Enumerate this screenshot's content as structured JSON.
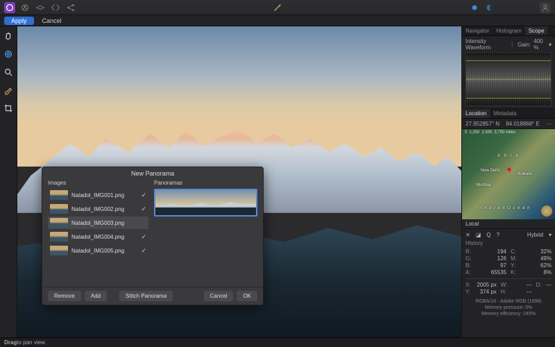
{
  "actionbar": {
    "apply": "Apply",
    "cancel": "Cancel"
  },
  "tabs": {
    "navigator": "Navigator",
    "histogram": "Histogram",
    "scope": "Scope"
  },
  "scope": {
    "title": "Intensity Waveform",
    "gain_label": "Gain:",
    "gain_value": "400 %"
  },
  "location": {
    "tab_location": "Location",
    "tab_metadata": "Metadata",
    "lat": "27.952857° N",
    "lon": "84.018868° E",
    "scale_0": "0",
    "scale_1": "1,250",
    "scale_2": "2,500",
    "scale_3": "3,750 miles",
    "label_asia": "A  S  I  A",
    "label_newdelhi": "New Delhi",
    "label_kolkata": "Kolkata",
    "label_mumbai": "Mumbai",
    "label_ocean": "I n d i a n   O c e a n",
    "local": "Local"
  },
  "info": {
    "tab_history": "History",
    "hybrid": "Hybrid",
    "R_lbl": "R:",
    "R": "194",
    "G_lbl": "G:",
    "G": "126",
    "B_lbl": "B:",
    "B": "97",
    "A_lbl": "A:",
    "A": "65535",
    "C_lbl": "C:",
    "C": "32%",
    "M_lbl": "M:",
    "M": "49%",
    "Y_lbl": "Y:",
    "Y": "62%",
    "K_lbl": "K:",
    "K": "8%",
    "X_lbl": "X:",
    "X": "2005 px",
    "Ypx_lbl": "Y:",
    "Ypx": "374 px",
    "W_lbl": "W:",
    "W": "---",
    "D_lbl": "D:",
    "D": "---",
    "H_lbl": "H:",
    "H": "---",
    "profile": "RGBA/16 - Adobe RGB (1998)",
    "mem_pressure": "Memory pressure: 0%",
    "mem_eff": "Memory efficiency: 245%"
  },
  "status": {
    "hint_strong": "Drag",
    "hint_rest": " to pan view."
  },
  "dialog": {
    "title": "New Panorama",
    "images_label": "Images",
    "panoramas_label": "Panoramas",
    "images": [
      {
        "name": "Natadol_IMG001.png",
        "checked": true,
        "sel": false
      },
      {
        "name": "Natadol_IMG002.png",
        "checked": true,
        "sel": false
      },
      {
        "name": "Natadol_IMG003.png",
        "checked": false,
        "sel": true
      },
      {
        "name": "Natadol_IMG004.png",
        "checked": true,
        "sel": false
      },
      {
        "name": "Natadol_IMG005.png",
        "checked": true,
        "sel": false
      }
    ],
    "btn_remove": "Remove",
    "btn_add": "Add",
    "btn_stitch": "Stitch Panorama",
    "btn_cancel": "Cancel",
    "btn_ok": "OK"
  }
}
